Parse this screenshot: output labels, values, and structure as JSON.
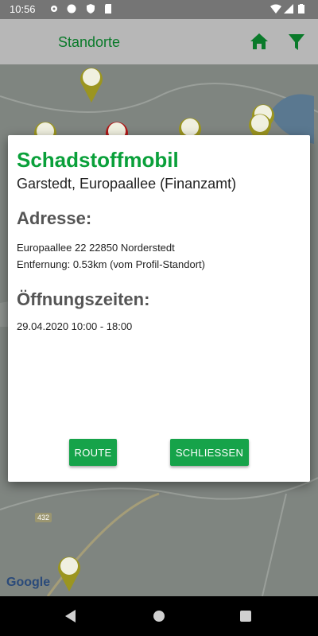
{
  "status_bar": {
    "time": "10:56"
  },
  "appbar": {
    "title": "Standorte"
  },
  "map": {
    "google_logo": "Google",
    "road_label": "432"
  },
  "dialog": {
    "title": "Schadstoffmobil",
    "subtitle": "Garstedt, Europaallee (Finanzamt)",
    "address_heading": "Adresse:",
    "address_line": "Europaallee 22 22850 Norderstedt",
    "distance_line": "Entfernung: 0.53km (vom Profil-Standort)",
    "hours_heading": "Öffnungszeiten:",
    "hours_line": "29.04.2020 10:00 - 18:00",
    "route_button": "ROUTE",
    "close_button": "SCHLIESSEN"
  },
  "colors": {
    "accent": "#16a34a",
    "title_green": "#0aa03a",
    "appbar_green": "#0a7a2a"
  }
}
